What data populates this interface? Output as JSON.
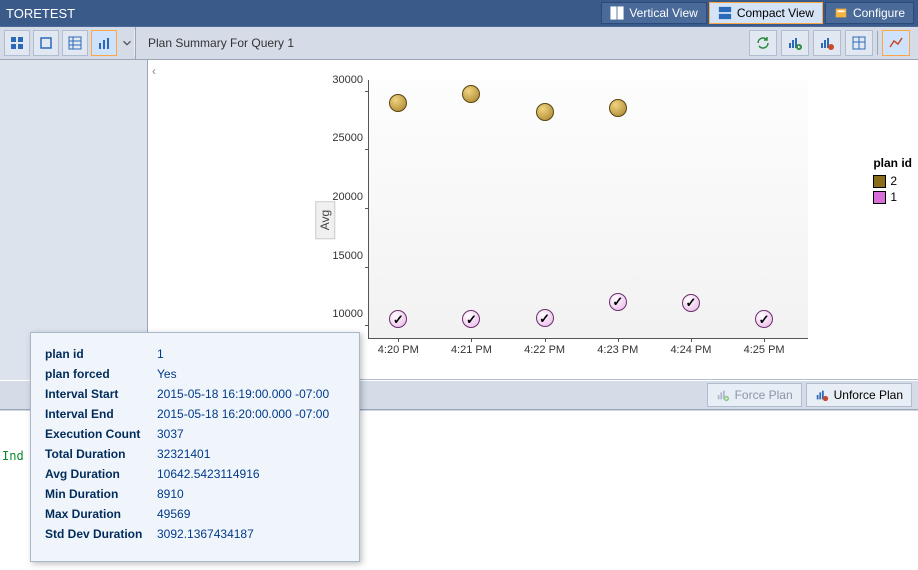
{
  "titlebar": {
    "title": "TORETEST",
    "vertical_view": "Vertical View",
    "compact_view": "Compact View",
    "configure": "Configure"
  },
  "summary": {
    "title": "Plan Summary For Query 1",
    "ylabel": "Avg"
  },
  "legend": {
    "title": "plan id",
    "items": [
      {
        "label": "2",
        "class": "gold"
      },
      {
        "label": "1",
        "class": "mag"
      }
    ]
  },
  "forcebar": {
    "force": "Force Plan",
    "unforce": "Unforce Plan"
  },
  "lower": {
    "ind": "Ind"
  },
  "tooltip": {
    "rows": [
      {
        "k": "plan id",
        "v": "1"
      },
      {
        "k": "plan forced",
        "v": "Yes"
      },
      {
        "k": "Interval Start",
        "v": "2015-05-18 16:19:00.000 -07:00"
      },
      {
        "k": "Interval End",
        "v": "2015-05-18 16:20:00.000 -07:00"
      },
      {
        "k": "Execution Count",
        "v": "3037"
      },
      {
        "k": "Total Duration",
        "v": "32321401"
      },
      {
        "k": "Avg Duration",
        "v": "10642.5423114916"
      },
      {
        "k": "Min Duration",
        "v": "8910"
      },
      {
        "k": "Max Duration",
        "v": "49569"
      },
      {
        "k": "Std Dev Duration",
        "v": "3092.1367434187"
      }
    ]
  },
  "chart_data": {
    "type": "scatter",
    "title": "Plan Summary For Query 1",
    "xlabel": "",
    "ylabel": "Avg",
    "ylim": [
      9000,
      31000
    ],
    "yticks": [
      10000,
      15000,
      20000,
      25000,
      30000
    ],
    "x_categories": [
      "4:20 PM",
      "4:21 PM",
      "4:22 PM",
      "4:23 PM",
      "4:24 PM",
      "4:25 PM"
    ],
    "series": [
      {
        "name": "2",
        "plan_id": 2,
        "forced": false,
        "color": "#a6812b",
        "points": [
          {
            "x": "4:20 PM",
            "y": 29000
          },
          {
            "x": "4:21 PM",
            "y": 29800
          },
          {
            "x": "4:22 PM",
            "y": 28300
          },
          {
            "x": "4:23 PM",
            "y": 28600
          }
        ]
      },
      {
        "name": "1",
        "plan_id": 1,
        "forced": true,
        "color": "#d86ed8",
        "points": [
          {
            "x": "4:20 PM",
            "y": 10600
          },
          {
            "x": "4:21 PM",
            "y": 10600
          },
          {
            "x": "4:22 PM",
            "y": 10700
          },
          {
            "x": "4:23 PM",
            "y": 12100
          },
          {
            "x": "4:24 PM",
            "y": 12000
          },
          {
            "x": "4:25 PM",
            "y": 10600
          }
        ]
      }
    ]
  }
}
